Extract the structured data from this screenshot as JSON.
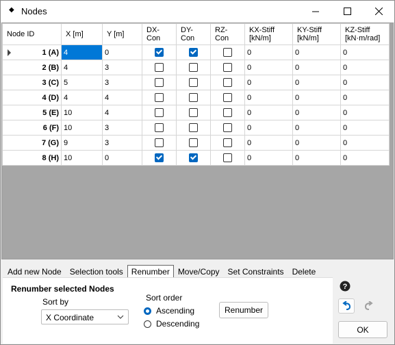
{
  "window": {
    "title": "Nodes"
  },
  "grid": {
    "headers": [
      "Node ID",
      "X [m]",
      "Y [m]",
      "DX-Con",
      "DY-Con",
      "RZ-Con",
      "KX-Stiff [kN/m]",
      "KY-Stiff [kN/m]",
      "KZ-Stiff [kN·m/rad]"
    ],
    "headers_line2": [
      "",
      "",
      "",
      "",
      "",
      "",
      "[kN/m]",
      "[kN/m]",
      "[kN·m/rad]"
    ],
    "headers_line1": [
      "Node ID",
      "X [m]",
      "Y [m]",
      "DX-Con",
      "DY-Con",
      "RZ-Con",
      "KX-Stiff",
      "KY-Stiff",
      "KZ-Stiff"
    ],
    "rows": [
      {
        "id": "1 (A)",
        "x": "4",
        "y": "0",
        "dx": true,
        "dy": true,
        "rz": false,
        "kx": "0",
        "ky": "0",
        "kz": "0"
      },
      {
        "id": "2 (B)",
        "x": "4",
        "y": "3",
        "dx": false,
        "dy": false,
        "rz": false,
        "kx": "0",
        "ky": "0",
        "kz": "0"
      },
      {
        "id": "3 (C)",
        "x": "5",
        "y": "3",
        "dx": false,
        "dy": false,
        "rz": false,
        "kx": "0",
        "ky": "0",
        "kz": "0"
      },
      {
        "id": "4 (D)",
        "x": "4",
        "y": "4",
        "dx": false,
        "dy": false,
        "rz": false,
        "kx": "0",
        "ky": "0",
        "kz": "0"
      },
      {
        "id": "5 (E)",
        "x": "10",
        "y": "4",
        "dx": false,
        "dy": false,
        "rz": false,
        "kx": "0",
        "ky": "0",
        "kz": "0"
      },
      {
        "id": "6 (F)",
        "x": "10",
        "y": "3",
        "dx": false,
        "dy": false,
        "rz": false,
        "kx": "0",
        "ky": "0",
        "kz": "0"
      },
      {
        "id": "7 (G)",
        "x": "9",
        "y": "3",
        "dx": false,
        "dy": false,
        "rz": false,
        "kx": "0",
        "ky": "0",
        "kz": "0"
      },
      {
        "id": "8 (H)",
        "x": "10",
        "y": "0",
        "dx": true,
        "dy": true,
        "rz": false,
        "kx": "0",
        "ky": "0",
        "kz": "0"
      }
    ]
  },
  "tabs": [
    "Add new Node",
    "Selection tools",
    "Renumber",
    "Move/Copy",
    "Set Constraints",
    "Delete"
  ],
  "active_tab": "Renumber",
  "renumber": {
    "title": "Renumber selected Nodes",
    "sort_by_label": "Sort by",
    "sort_by_value": "X Coordinate",
    "sort_order_label": "Sort order",
    "ascending_label": "Ascending",
    "descending_label": "Descending",
    "renumber_button": "Renumber"
  },
  "ok_label": "OK",
  "colors": {
    "accent": "#0067c0",
    "selection": "#0078d7",
    "empty_grid": "#a6a6a6"
  }
}
